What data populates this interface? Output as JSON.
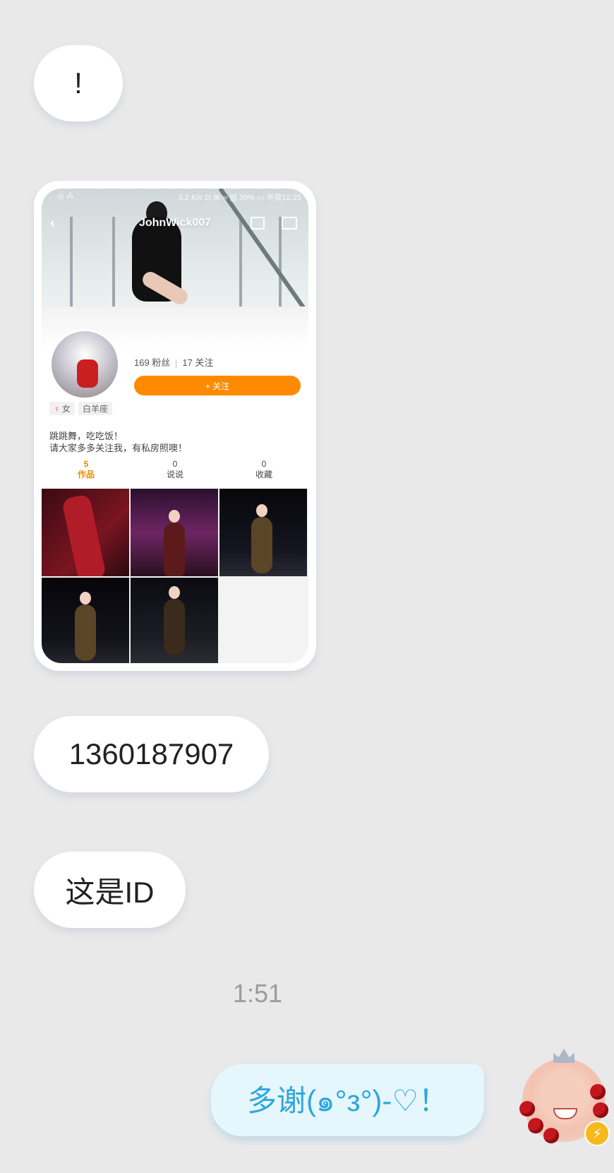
{
  "messages": {
    "exclaim": "!",
    "phone_number": "1360187907",
    "id_note": "这是ID",
    "time": "1:51",
    "reply": "多谢(๑°з°)-♡！"
  },
  "screenshot": {
    "status_left": "... ◎ ⁂",
    "status_right": "3.2 K/s ⊡ ⊞ ∞ ▥ 39% ▭ 半夜12:25",
    "username": "JohnWick007",
    "fans": "169 粉丝",
    "following": "17 关注",
    "follow_button": "+ 关注",
    "tag_gender": "女",
    "tag_zodiac": "白羊座",
    "bio_line1": "跳跳舞，吃吃饭！",
    "bio_line2": "请大家多多关注我，有私房照噢！",
    "counts": [
      {
        "value": "5",
        "label": "作品"
      },
      {
        "value": "0",
        "label": "说说"
      },
      {
        "value": "0",
        "label": "收藏"
      }
    ]
  },
  "colors": {
    "background": "#e9e9ea",
    "incoming_bubble": "#ffffff",
    "outgoing_bubble": "#e6f6fd",
    "outgoing_text": "#2ea6dc",
    "follow_orange": "#ff8a00"
  },
  "icons": {
    "back": "chevron-left-icon",
    "mail": "mail-icon",
    "add_friend": "add-friend-icon",
    "female": "female-icon",
    "vip_badge": "lightning-icon"
  }
}
